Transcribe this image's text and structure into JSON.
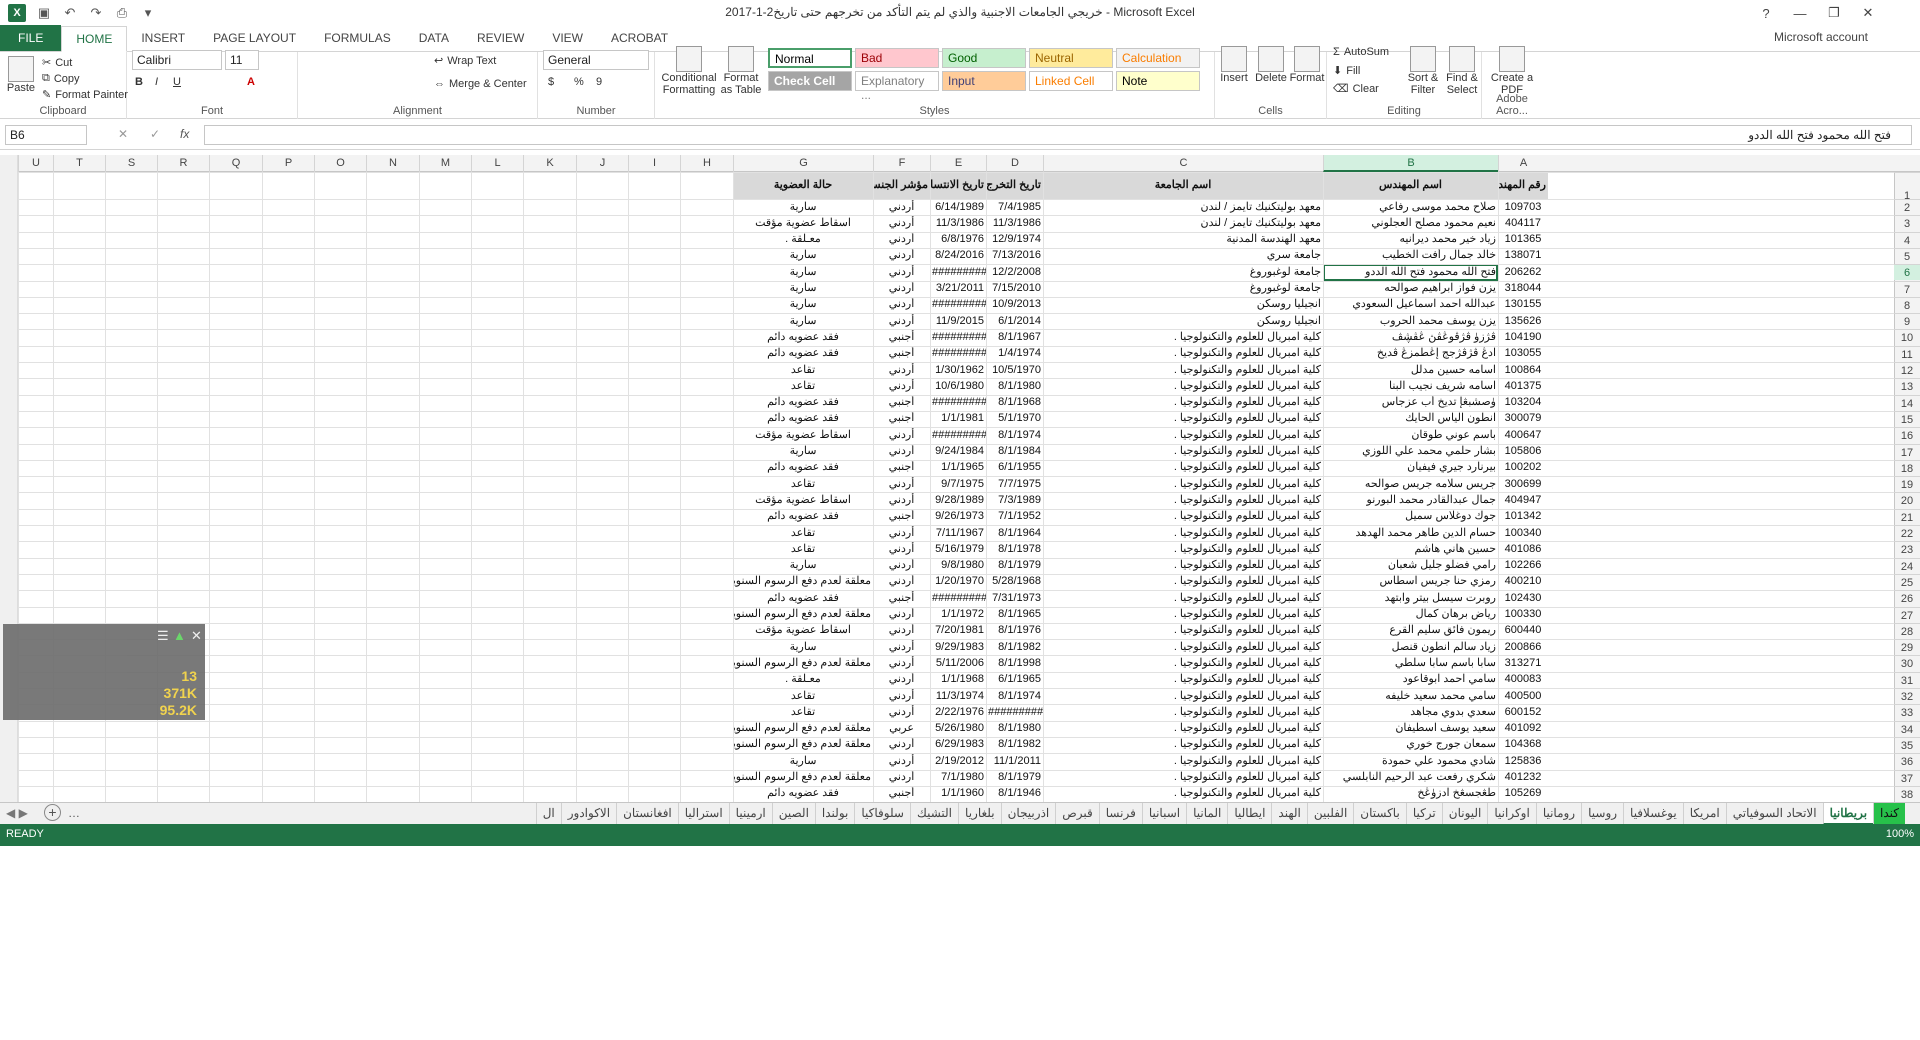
{
  "titlebar": {
    "title": "خريجي الجامعات الاجنبية والذي لم يتم التأكد من تخرجهم حتى تاريخ2-1-2017 - Microsoft Excel",
    "logo": "X",
    "help": "?",
    "minimize": "—",
    "restore": "❐",
    "close": "✕"
  },
  "ribbon": {
    "tabs": [
      "FILE",
      "HOME",
      "INSERT",
      "PAGE LAYOUT",
      "FORMULAS",
      "DATA",
      "REVIEW",
      "VIEW",
      "ACROBAT"
    ],
    "account": "Microsoft account",
    "clipboard": {
      "paste": "Paste",
      "cut": "Cut",
      "copy": "Copy",
      "format_painter": "Format Painter",
      "label": "Clipboard"
    },
    "font": {
      "name": "Calibri",
      "size": "11",
      "label": "Font",
      "bold": "B",
      "italic": "I",
      "underline": "U"
    },
    "alignment": {
      "wrap": "Wrap Text",
      "merge": "Merge & Center",
      "label": "Alignment"
    },
    "number": {
      "format": "General",
      "currency": "$",
      "percent": "%",
      "comma": "9",
      "label": "Number"
    },
    "styles": {
      "conditional": "Conditional Formatting",
      "format_table": "Format as Table",
      "cells": [
        {
          "name": "Normal",
          "bg": "#ffffff",
          "fg": "#000000"
        },
        {
          "name": "Bad",
          "bg": "#ffc7ce",
          "fg": "#9c0006"
        },
        {
          "name": "Good",
          "bg": "#c6efce",
          "fg": "#006100"
        },
        {
          "name": "Neutral",
          "bg": "#ffeb9c",
          "fg": "#9c6500"
        },
        {
          "name": "Calculation",
          "bg": "#f2f2f2",
          "fg": "#fa7d00"
        },
        {
          "name": "Check Cell",
          "bg": "#a5a5a5",
          "fg": "#ffffff"
        },
        {
          "name": "Explanatory ...",
          "bg": "#ffffff",
          "fg": "#7f7f7f"
        },
        {
          "name": "Input",
          "bg": "#ffcc99",
          "fg": "#3f3f76"
        },
        {
          "name": "Linked Cell",
          "bg": "#ffffff",
          "fg": "#fa7d00"
        },
        {
          "name": "Note",
          "bg": "#ffffcc",
          "fg": "#000000"
        }
      ],
      "label": "Styles"
    },
    "cells_group": {
      "insert": "Insert",
      "delete": "Delete",
      "format": "Format",
      "label": "Cells"
    },
    "editing": {
      "autosum": "AutoSum",
      "fill": "Fill",
      "clear": "Clear",
      "sort": "Sort & Filter",
      "find": "Find & Select",
      "label": "Editing"
    },
    "acrobat": {
      "create": "Create a PDF",
      "label": "Adobe Acro..."
    }
  },
  "formula_bar": {
    "name_box": "B6",
    "fx": "fx",
    "value": "فتح الله محمود فتح الله الددو"
  },
  "columns": [
    "U",
    "T",
    "S",
    "R",
    "Q",
    "P",
    "O",
    "N",
    "M",
    "L",
    "K",
    "J",
    "I",
    "H",
    "G",
    "F",
    "E",
    "D",
    "C",
    "B",
    "A"
  ],
  "selected_col": "B",
  "selected_row": "6",
  "headers": {
    "A": "رقم المهندس",
    "B": "اسم المهندس",
    "C": "اسم الجامعة",
    "D": "تاريخ التخرج",
    "E": "تاريخ الانتساب",
    "F": "مؤشر الجنسية",
    "G": "حالة العضوية"
  },
  "rows": [
    [
      "109703",
      "صلاح محمد موسى رفاعي",
      "معهد بوليتكنيك تايمز / لندن",
      "7/4/1985",
      "6/14/1989",
      "أردني",
      "سارية"
    ],
    [
      "404117",
      "نعيم محمود مصلح العجلوني",
      "معهد بوليتكنيك تايمز / لندن",
      "11/3/1986",
      "11/3/1986",
      "أردني",
      "اسقاط عضوية مؤقت"
    ],
    [
      "101365",
      "زياد خير محمد ديرانيه",
      "معهد الهندسة المدنية",
      "12/9/1974",
      "6/8/1976",
      "أردني",
      "معـلقة ."
    ],
    [
      "138071",
      "خالد جمال رأفت الخطيب",
      "جامعة سري",
      "7/13/2016",
      "8/24/2016",
      "أردني",
      "سارية"
    ],
    [
      "206262",
      "فتح الله محمود فتح الله الددو",
      "جامعة لوغبوروغ",
      "12/2/2008",
      "##########",
      "أردني",
      "سارية"
    ],
    [
      "318044",
      "يزن فواز ابراهيم صوالحه",
      "جامعة لوغبوروغ",
      "7/15/2010",
      "3/21/2011",
      "أردني",
      "سارية"
    ],
    [
      "130155",
      "عبدالله احمد اسماعيل السعودي",
      "انجيليا روسكن",
      "10/9/2013",
      "##########",
      "أردني",
      "سارية"
    ],
    [
      "135626",
      "يزن يوسف محمد الحروب",
      "انجيليا روسكن",
      "6/1/2014",
      "11/9/2015",
      "أردني",
      "سارية"
    ],
    [
      "104190",
      "ڤژزۈ ڤژڤوڠڤڽ ڠڤڜڤ",
      "كلية امبريال للعلوم والتكنولوجيا .",
      "8/1/1967",
      "##########",
      "أجنبي",
      "فقد عضويه دائم"
    ],
    [
      "103055",
      "ادڠ ڤژڤژجج إڠطمزڠ ڤديخ",
      "كلية امبريال للعلوم والتكنولوجيا .",
      "1/4/1974",
      "##########",
      "أجنبي",
      "فقد عضويه دائم"
    ],
    [
      "100864",
      "اسامه حسين مدلل",
      "كلية امبريال للعلوم والتكنولوجيا .",
      "10/5/1970",
      "1/30/1962",
      "أردني",
      "تقاعد"
    ],
    [
      "401375",
      "اسامه شريف نجيب البنا",
      "كلية امبريال للعلوم والتكنولوجيا .",
      "8/1/1980",
      "10/6/1980",
      "أردني",
      "تقاعد"
    ],
    [
      "103204",
      "ۈصشبڠإ تديخ أب عزجاس",
      "كلية امبريال للعلوم والتكنولوجيا .",
      "8/1/1968",
      "##########",
      "أجنبي",
      "فقد عضويه دائم"
    ],
    [
      "300079",
      "انطون الياس الحايك",
      "كلية امبريال للعلوم والتكنولوجيا .",
      "5/1/1970",
      "1/1/1981",
      "أجنبي",
      "فقد عضويه دائم"
    ],
    [
      "400647",
      "باسم عوني طوقان",
      "كلية امبريال للعلوم والتكنولوجيا .",
      "8/1/1974",
      "##########",
      "أردني",
      "اسقاط عضوية مؤقت"
    ],
    [
      "105806",
      "بشار حلمي محمد علي اللوزي",
      "كلية امبريال للعلوم والتكنولوجيا .",
      "8/1/1984",
      "9/24/1984",
      "أردني",
      "سارية"
    ],
    [
      "100202",
      "بيرنارد جيري فيفيان",
      "كلية امبريال للعلوم والتكنولوجيا .",
      "6/1/1955",
      "1/1/1965",
      "أجنبي",
      "فقد عضويه دائم"
    ],
    [
      "300699",
      "جريس سلامه جريس صوالحه",
      "كلية امبريال للعلوم والتكنولوجيا .",
      "7/7/1975",
      "9/7/1975",
      "أردني",
      "تقاعد"
    ],
    [
      "404947",
      "جمال عبدالقادر محمد البورنو",
      "كلية امبريال للعلوم والتكنولوجيا .",
      "7/3/1989",
      "9/28/1989",
      "أردني",
      "اسقاط عضوية مؤقت"
    ],
    [
      "101342",
      "جوك دوغلاس سميل",
      "كلية امبريال للعلوم والتكنولوجيا .",
      "7/1/1952",
      "9/26/1973",
      "أجنبي",
      "فقد عضويه دائم"
    ],
    [
      "100340",
      "حسام الدين طاهر محمد الهدهد",
      "كلية امبريال للعلوم والتكنولوجيا .",
      "8/1/1964",
      "7/11/1967",
      "أردني",
      "تقاعد"
    ],
    [
      "401086",
      "حسين هاني هاشم",
      "كلية امبريال للعلوم والتكنولوجيا .",
      "8/1/1978",
      "5/16/1979",
      "أردني",
      "تقاعد"
    ],
    [
      "102266",
      "رامي فضلو جليل شعبان",
      "كلية امبريال للعلوم والتكنولوجيا .",
      "8/1/1979",
      "9/8/1980",
      "أردني",
      "سارية"
    ],
    [
      "400210",
      "رمزي حنا جريس اسطاس",
      "كلية امبريال للعلوم والتكنولوجيا .",
      "5/28/1968",
      "1/20/1970",
      "أردني",
      "معلقة لعدم دفع الرسوم السنوية"
    ],
    [
      "102430",
      "روبرت سيسل بيتر وابتهد",
      "كلية امبريال للعلوم والتكنولوجيا .",
      "7/31/1973",
      "##########",
      "أجنبي",
      "فقد عضويه دائم"
    ],
    [
      "100330",
      "رياض برهان كمال",
      "كلية امبريال للعلوم والتكنولوجيا .",
      "8/1/1965",
      "1/1/1972",
      "أردني",
      "معلقة لعدم دفع الرسوم السنوية"
    ],
    [
      "600440",
      "ريمون فائق سليم القرع",
      "كلية امبريال للعلوم والتكنولوجيا .",
      "8/1/1976",
      "7/20/1981",
      "أردني",
      "اسقاط عضوية مؤقت"
    ],
    [
      "200866",
      "زياد سالم انطون قنصل",
      "كلية امبريال للعلوم والتكنولوجيا .",
      "8/1/1982",
      "9/29/1983",
      "أردني",
      "سارية"
    ],
    [
      "313271",
      "سابا باسم سابا سلطي",
      "كلية امبريال للعلوم والتكنولوجيا .",
      "8/1/1998",
      "5/11/2006",
      "أردني",
      "معلقة لعدم دفع الرسوم السنوية"
    ],
    [
      "400083",
      "سامي احمد ابوقاعود",
      "كلية امبريال للعلوم والتكنولوجيا .",
      "6/1/1965",
      "1/1/1968",
      "أردني",
      "معـلقة ."
    ],
    [
      "400500",
      "سامي محمد سعيد خليفه",
      "كلية امبريال للعلوم والتكنولوجيا .",
      "8/1/1974",
      "11/3/1974",
      "أردني",
      "تقاعد"
    ],
    [
      "600152",
      "سعدي بدوي مجاهد",
      "كلية امبريال للعلوم والتكنولوجيا .",
      "##########",
      "2/22/1976",
      "أردني",
      "تقاعد"
    ],
    [
      "401092",
      "سعيد يوسف اسطيفان",
      "كلية امبريال للعلوم والتكنولوجيا .",
      "8/1/1980",
      "5/26/1980",
      "عربي",
      "معلقة لعدم دفع الرسوم السنوية"
    ],
    [
      "104368",
      "سمعان جورج خوري",
      "كلية امبريال للعلوم والتكنولوجيا .",
      "8/1/1982",
      "6/29/1983",
      "أردني",
      "معلقة لعدم دفع الرسوم السنوية"
    ],
    [
      "125836",
      "شادي محمود علي حمودة",
      "كلية امبريال للعلوم والتكنولوجيا .",
      "11/1/2011",
      "2/19/2012",
      "أردني",
      "سارية"
    ],
    [
      "401232",
      "شكري رفعت عبد الرحيم النابلسي",
      "كلية امبريال للعلوم والتكنولوجيا .",
      "8/1/1979",
      "7/1/1980",
      "أردني",
      "معلقة لعدم دفع الرسوم السنوية"
    ],
    [
      "105269",
      "طڠجسڠخ ادزۈڠخ",
      "كلية امبريال للعلوم والتكنولوجيا .",
      "8/1/1946",
      "1/1/1960",
      "أجنبي",
      "فقد عضويه دائم"
    ]
  ],
  "overlay": {
    "v1": "13",
    "v2": "371K",
    "v3": "95.2K"
  },
  "sheet_tabs": [
    "كندا",
    "بريطانيا",
    "الاتحاد السوفياتي",
    "امريكا",
    "يوغسلافيا",
    "روسيا",
    "رومانيا",
    "اوكرانيا",
    "اليونان",
    "تركيا",
    "باكستان",
    "الفلبين",
    "الهند",
    "ايطاليا",
    "المانيا",
    "اسبانيا",
    "فرنسا",
    "قبرص",
    "اذربيجان",
    "بلغاريا",
    "التشيك",
    "سلوفاكيا",
    "بولندا",
    "الصين",
    "ارمينيا",
    "استراليا",
    "افغانستان",
    "الاكوادور",
    "ال"
  ],
  "active_sheet": "بريطانيا",
  "colored_sheet": "كندا",
  "status": {
    "ready": "READY",
    "zoom": "100%"
  }
}
